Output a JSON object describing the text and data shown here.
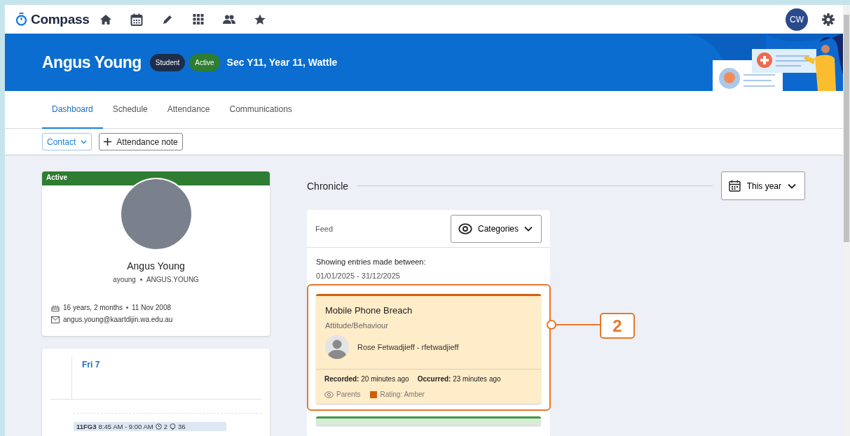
{
  "nav": {
    "logo": "Compass",
    "avatar_initials": "CW"
  },
  "header": {
    "name": "Angus Young",
    "badges": [
      {
        "label": "Student",
        "kind": "role"
      },
      {
        "label": "Active",
        "kind": "status"
      }
    ],
    "details": "Sec Y11, Year 11, Wattle"
  },
  "tabs": [
    {
      "label": "Dashboard",
      "selected": true
    },
    {
      "label": "Schedule",
      "selected": false
    },
    {
      "label": "Attendance",
      "selected": false
    },
    {
      "label": "Communications",
      "selected": false
    }
  ],
  "toolbar": {
    "contact": "Contact",
    "attendance_note": "Attendance note"
  },
  "profile": {
    "status": "Active",
    "name": "Angus Young",
    "username": "ayoung",
    "code": "ANGUS.YOUNG",
    "age": "16 years, 2 months",
    "birth_date": "11 Nov 2008",
    "email": "angus.young@kaartdijin.wa.edu.au"
  },
  "calendar": {
    "day": "Fri 7",
    "events": [
      {
        "class": "11FG3",
        "time": "8:45 AM - 9:00 AM",
        "count_1": "2",
        "count_2": "36"
      }
    ]
  },
  "chronicle": {
    "title": "Chronicle",
    "range": "This year",
    "feed": {
      "label": "Feed",
      "filter": "Categories",
      "range_label": "Showing entries made between:",
      "range": "01/01/2025 - 31/12/2025",
      "entries": [
        {
          "title": "Mobile Phone Breach",
          "category": "Attitude/Behaviour",
          "staff": "Rose Fetwadjieff - rfetwadjieff",
          "recorded": "**Recorded:** 20 minutes ago",
          "occurred": "**Occurred:** 23 minutes ago",
          "visibility": "Parents",
          "rating": "Rating: Amber",
          "color": "#d35f0a",
          "annotation": "2"
        },
        {
          "color": "#3c9a43"
        }
      ]
    }
  }
}
